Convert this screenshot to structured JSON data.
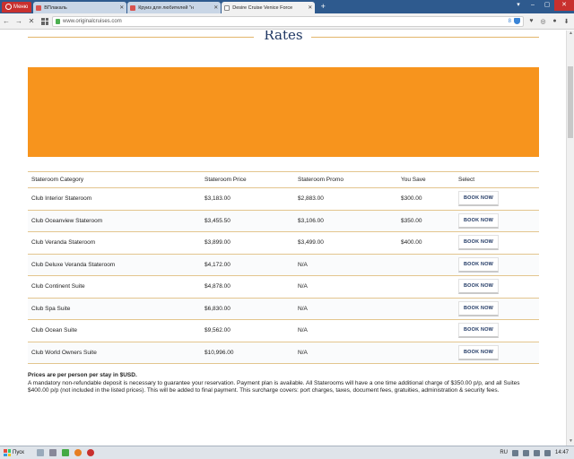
{
  "browser": {
    "menu_label": "Меню",
    "tabs": [
      {
        "title": "ВПлакаль",
        "favicon_color": "#d9534f",
        "active": false
      },
      {
        "title": "Круиз для любителей \"н",
        "favicon_color": "#d9534f",
        "active": false
      },
      {
        "title": "Desire Cruise Venice Force",
        "favicon_color": "#888888",
        "active": true
      }
    ],
    "url": "www.originalcruises.com"
  },
  "page": {
    "title": "Rates",
    "banner_color": "#f7941d",
    "table": {
      "headers": [
        "Stateroom Category",
        "Stateroom Price",
        "Stateroom Promo",
        "You Save",
        "Select"
      ],
      "rows": [
        {
          "category": "Club Interior Stateroom",
          "price": "$3,183.00",
          "promo": "$2,883.00",
          "save": "$300.00",
          "action": "BOOK NOW"
        },
        {
          "category": "Club Oceanview Stateroom",
          "price": "$3,455.50",
          "promo": "$3,106.00",
          "save": "$350.00",
          "action": "BOOK NOW"
        },
        {
          "category": "Club Veranda Stateroom",
          "price": "$3,899.00",
          "promo": "$3,499.00",
          "save": "$400.00",
          "action": "BOOK NOW"
        },
        {
          "category": "Club Deluxe Veranda Stateroom",
          "price": "$4,172.00",
          "promo": "N/A",
          "save": "",
          "action": "BOOK NOW"
        },
        {
          "category": "Club Continent Suite",
          "price": "$4,878.00",
          "promo": "N/A",
          "save": "",
          "action": "BOOK NOW"
        },
        {
          "category": "Club Spa Suite",
          "price": "$6,830.00",
          "promo": "N/A",
          "save": "",
          "action": "BOOK NOW"
        },
        {
          "category": "Club Ocean Suite",
          "price": "$9,562.00",
          "promo": "N/A",
          "save": "",
          "action": "BOOK NOW"
        },
        {
          "category": "Club World Owners Suite",
          "price": "$10,996.00",
          "promo": "N/A",
          "save": "",
          "action": "BOOK NOW"
        }
      ]
    },
    "notes_heading": "Prices are per person per stay in $USD.",
    "notes_body": "A mandatory non-refundable deposit is necessary to guarantee your reservation. Payment plan is available. All Staterooms will have a one time additional charge of $350.00 p/p, and all Suites $400.00 p/p (not included in the listed prices). This will be added to final payment. This surcharge covers: port charges, taxes, document fees, gratuities, administration & security fees."
  },
  "taskbar": {
    "start_label": "Пуск",
    "language": "RU",
    "time": "14:47"
  }
}
